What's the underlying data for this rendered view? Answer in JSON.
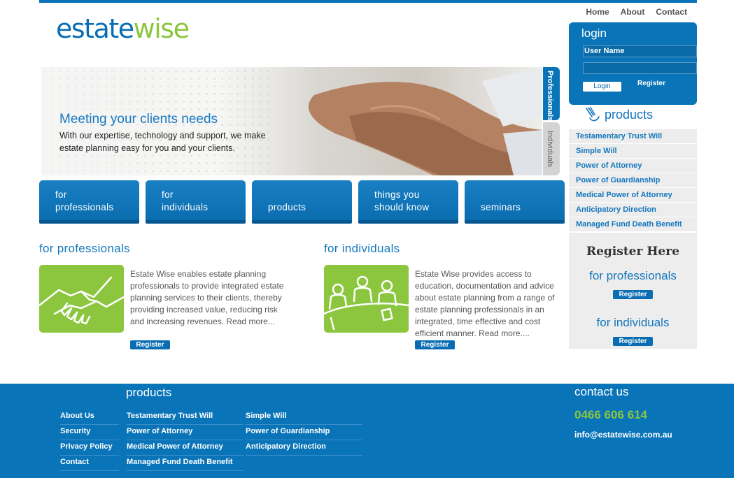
{
  "brand": {
    "logo_part1": "estate",
    "logo_part2": "wise",
    "primary_color": "#0a74b8",
    "accent_color": "#8cc63f"
  },
  "topnav": [
    "Home",
    "About",
    "Contact"
  ],
  "banner": {
    "headline": "Meeting your clients needs",
    "text": "With our expertise, technology and support, we make estate planning easy for you and your clients.",
    "tab_professionals": "Professionals",
    "tab_individuals": "Individuals"
  },
  "tiles": [
    {
      "line1": "for",
      "line2": "professionals"
    },
    {
      "line1": "for",
      "line2": "individuals"
    },
    {
      "line1": "",
      "line2": "products"
    },
    {
      "line1": "things you",
      "line2": "should know"
    },
    {
      "line1": "",
      "line2": "seminars"
    }
  ],
  "professionals": {
    "title": "for professionals",
    "text": "Estate Wise enables estate planning professionals to provide integrated estate planning services to their clients, thereby providing increased value, reducing risk and increasing revenues. Read more...",
    "button": "Register",
    "icon": "handshake-icon"
  },
  "individuals": {
    "title": "for individuals",
    "text": "Estate Wise provides access to education, documentation and advice about estate planning from a range of estate planning professionals in an integrated, time effective and cost efficient manner. Read more....",
    "button": "Register",
    "icon": "meeting-icon"
  },
  "login": {
    "title": "login",
    "username_label": "User Name",
    "login_button": "Login",
    "register_link": "Register"
  },
  "products": {
    "title": "products",
    "items": [
      "Testamentary Trust Will",
      "Simple Will",
      "Power of Attorney",
      "Power of Guardianship",
      "Medical Power of Attorney",
      "Anticipatory Direction",
      "Managed Fund Death Benefit"
    ]
  },
  "register_here": {
    "heading": "Register Here",
    "for_professionals": "for professionals",
    "for_individuals": "for individuals",
    "button": "Register"
  },
  "footer": {
    "products_title": "products",
    "col1": [
      "About Us",
      "Security",
      "Privacy Policy",
      "Contact"
    ],
    "col2": [
      "Testamentary Trust Will",
      "Power of Attorney",
      "Medical Power of Attorney",
      "Managed Fund Death Benefit"
    ],
    "col3": [
      "Simple Will",
      "Power of Guardianship",
      "Anticipatory Direction"
    ],
    "contact_title": "contact us",
    "phone": "0466 606 614",
    "email": "info@estatewise.com.au"
  }
}
